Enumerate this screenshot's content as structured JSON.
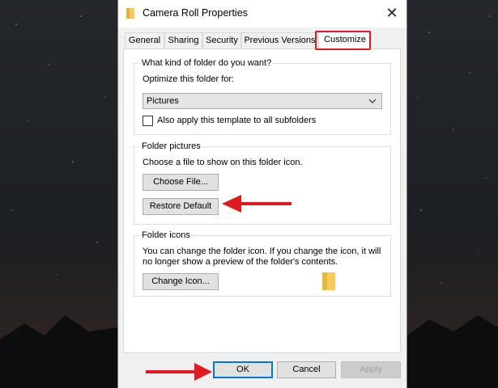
{
  "window": {
    "title": "Camera Roll Properties",
    "close_glyph": "✕"
  },
  "tabs": [
    {
      "label": "General"
    },
    {
      "label": "Sharing"
    },
    {
      "label": "Security"
    },
    {
      "label": "Previous Versions"
    },
    {
      "label": "Customize",
      "active": true
    }
  ],
  "folder_type": {
    "group_label": "What kind of folder do you want?",
    "optimize_label": "Optimize this folder for:",
    "selected_option": "Pictures",
    "apply_subfolders_label": "Also apply this template to all subfolders",
    "apply_subfolders_checked": false
  },
  "folder_pictures": {
    "group_label": "Folder pictures",
    "description": "Choose a file to show on this folder icon.",
    "choose_file_label": "Choose File...",
    "restore_default_label": "Restore Default"
  },
  "folder_icons": {
    "group_label": "Folder icons",
    "description_line1": "You can change the folder icon. If you change the icon, it will",
    "description_line2": "no longer show a preview of the folder's contents.",
    "change_icon_label": "Change Icon..."
  },
  "buttons": {
    "ok": "OK",
    "cancel": "Cancel",
    "apply": "Apply"
  },
  "colors": {
    "highlight_red": "#e01a22",
    "folder_yellow": "#f3cc57",
    "focus_blue": "#0078d7"
  },
  "icons": {
    "title": "folder-icon",
    "close": "close-icon",
    "dropdown": "chevron-down-icon",
    "preview": "folder-icon",
    "annotation": "red-arrow-icon"
  }
}
